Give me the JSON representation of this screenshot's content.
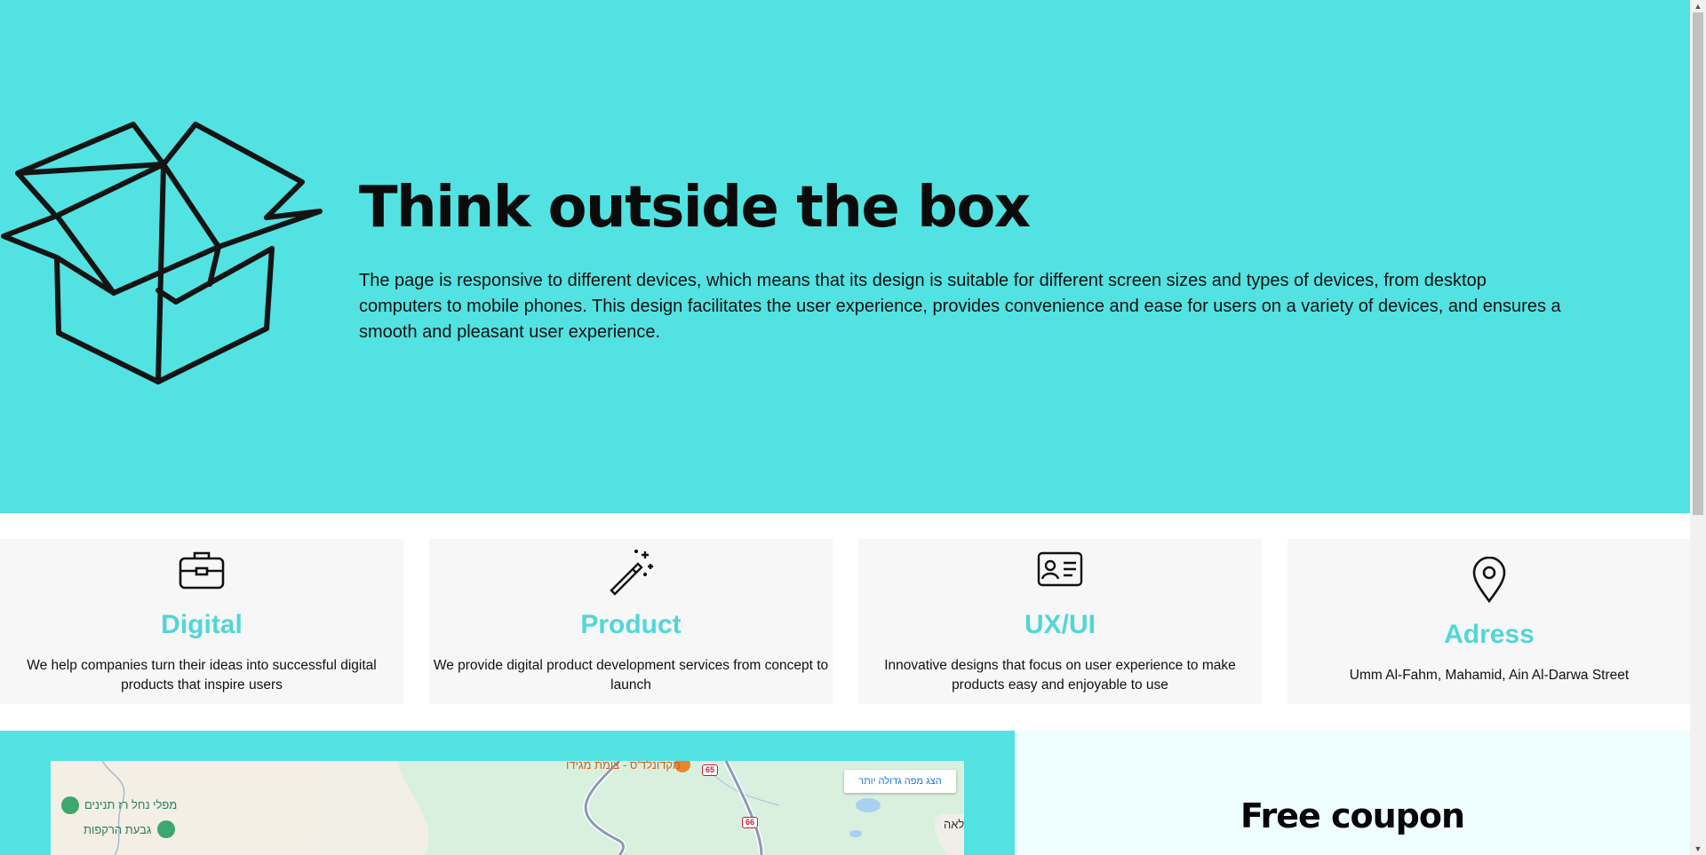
{
  "hero": {
    "title": "Think outside the box",
    "text": "The page is responsive to different devices, which means that its design is suitable for different screen sizes and types of devices, from desktop computers to mobile phones. This design facilitates the user experience, provides convenience and ease for users on a variety of devices, and ensures a smooth and pleasant user experience.",
    "icon": "open-box-illustration"
  },
  "cards": [
    {
      "icon": "briefcase-icon",
      "title": "Digital",
      "text": "We help companies turn their ideas into successful digital products that inspire users"
    },
    {
      "icon": "magic-wand-icon",
      "title": "Product",
      "text": "We provide digital product development services from concept to launch"
    },
    {
      "icon": "id-card-icon",
      "title": "UX/UI",
      "text": "Innovative designs that focus on user experience to make products easy and enjoyable to use"
    },
    {
      "icon": "map-pin-icon",
      "title": "Adress",
      "text": "Umm Al-Fahm, Mahamid, Ain Al-Darwa Street"
    }
  ],
  "map": {
    "larger_map_button": "הצג מפה גדולה יותר",
    "labels": {
      "poi_mcdonalds": "מקדונלד'ס - צומת מגידו",
      "park": "מפלי נחל רז תנינים",
      "hill": "גבעת הרקפות",
      "edge_text": "לאה"
    },
    "roads": [
      "65",
      "66"
    ]
  },
  "coupon": {
    "title": "Free coupon"
  },
  "colors": {
    "accent": "#52e2e1",
    "card_title": "#52d6d8",
    "card_bg": "#f7f7f7",
    "coupon_bg": "#effefe"
  }
}
